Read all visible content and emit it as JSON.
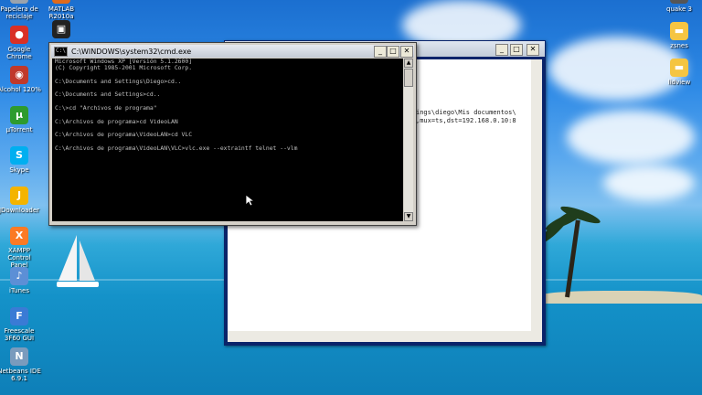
{
  "desktop_left": [
    {
      "label": "Papelera de\nreciclaje",
      "icon": "recycle-bin-icon",
      "color": "#9aa3ad",
      "glyph": "♻"
    },
    {
      "label": "Google\nChrome",
      "icon": "chrome-icon",
      "color": "#d93025",
      "glyph": "●"
    },
    {
      "label": "Alcohol 120%",
      "icon": "alcohol-icon",
      "color": "#c0392b",
      "glyph": "◉"
    },
    {
      "label": "µTorrent",
      "icon": "utorrent-icon",
      "color": "#2e9b2e",
      "glyph": "µ"
    },
    {
      "label": "Skype",
      "icon": "skype-icon",
      "color": "#00aff0",
      "glyph": "S"
    },
    {
      "label": "JDownloader",
      "icon": "jdownloader-icon",
      "color": "#f4b400",
      "glyph": "J"
    },
    {
      "label": "XAMPP Control\nPanel",
      "icon": "xampp-icon",
      "color": "#fb7a24",
      "glyph": "X"
    },
    {
      "label": "iTunes",
      "icon": "itunes-icon",
      "color": "#5c8fd6",
      "glyph": "♪"
    },
    {
      "label": "Freescale\n3F60 GUI",
      "icon": "freescale-icon",
      "color": "#3a7bd5",
      "glyph": "F"
    },
    {
      "label": "Netbeans IDE\n6.9.1",
      "icon": "netbeans-icon",
      "color": "#7a9bbd",
      "glyph": "N"
    }
  ],
  "desktop_second": [
    {
      "label": "MATLAB\nR2010a",
      "icon": "matlab-icon",
      "color": "#e06a1b",
      "glyph": "M"
    },
    {
      "label": "",
      "icon": "camera-icon",
      "color": "#222222",
      "glyph": "▣"
    }
  ],
  "desktop_right": [
    {
      "label": "quake 3",
      "icon": "quake-icon",
      "color": "#555555",
      "glyph": ""
    },
    {
      "label": "zsnes",
      "icon": "folder-icon",
      "color": "#f5c542",
      "glyph": "▬"
    },
    {
      "label": "lidview",
      "icon": "folder-icon",
      "color": "#f5c542",
      "glyph": "▬"
    }
  ],
  "cmd": {
    "title": "C:\\WINDOWS\\system32\\cmd.exe",
    "lines": [
      "Microsoft Windows XP [Versión 5.1.2600]",
      "(C) Copyright 1985-2001 Microsoft Corp.",
      "",
      "C:\\Documents and Settings\\Diego>cd..",
      "",
      "C:\\Documents and Settings>cd..",
      "",
      "C:\\>cd \"Archivos de programa\"",
      "",
      "C:\\Archivos de programa>cd VideoLAN",
      "",
      "C:\\Archivos de programa\\VideoLAN>cd VLC",
      "",
      "C:\\Archivos de programa\\VideoLAN\\VLC>vlc.exe --extraintf telnet --vlm"
    ]
  },
  "background_window": {
    "text_line1": "ings\\diego\\Mis documentos\\",
    "text_line2": ",mux=ts,dst=192.168.0.10:8"
  },
  "buttons": {
    "minimize": "_",
    "maximize": "□",
    "close": "✕"
  }
}
